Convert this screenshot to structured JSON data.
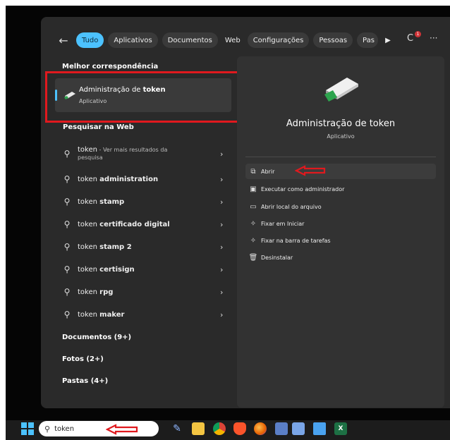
{
  "tabs": [
    "Tudo",
    "Aplicativos",
    "Documentos",
    "Web",
    "Configurações",
    "Pessoas",
    "Pas"
  ],
  "best_match": {
    "title": "Melhor correspondência",
    "name_prefix": "Administração de ",
    "name_bold": "token",
    "type": "Aplicativo"
  },
  "web": {
    "title": "Pesquisar na Web",
    "first": {
      "term": "token",
      "extra": " - Ver mais resultados da",
      "extra2": "pesquisa"
    },
    "items": [
      {
        "prefix": "token ",
        "bold": "administration"
      },
      {
        "prefix": "token ",
        "bold": "stamp"
      },
      {
        "prefix": "token ",
        "bold": "certificado digital"
      },
      {
        "prefix": "token ",
        "bold": "stamp 2"
      },
      {
        "prefix": "token ",
        "bold": "certisign"
      },
      {
        "prefix": "token ",
        "bold": "rpg"
      },
      {
        "prefix": "token ",
        "bold": "maker"
      }
    ]
  },
  "categories": [
    "Documentos (9+)",
    "Fotos (2+)",
    "Pastas (4+)"
  ],
  "detail": {
    "title": "Administração de token",
    "subtitle": "Aplicativo",
    "actions": [
      "Abrir",
      "Executar como administrador",
      "Abrir local do arquivo",
      "Fixar em Iniciar",
      "Fixar na barra de tarefas",
      "Desinstalar"
    ]
  },
  "taskbar": {
    "search_value": "token"
  },
  "notification_count": "1"
}
